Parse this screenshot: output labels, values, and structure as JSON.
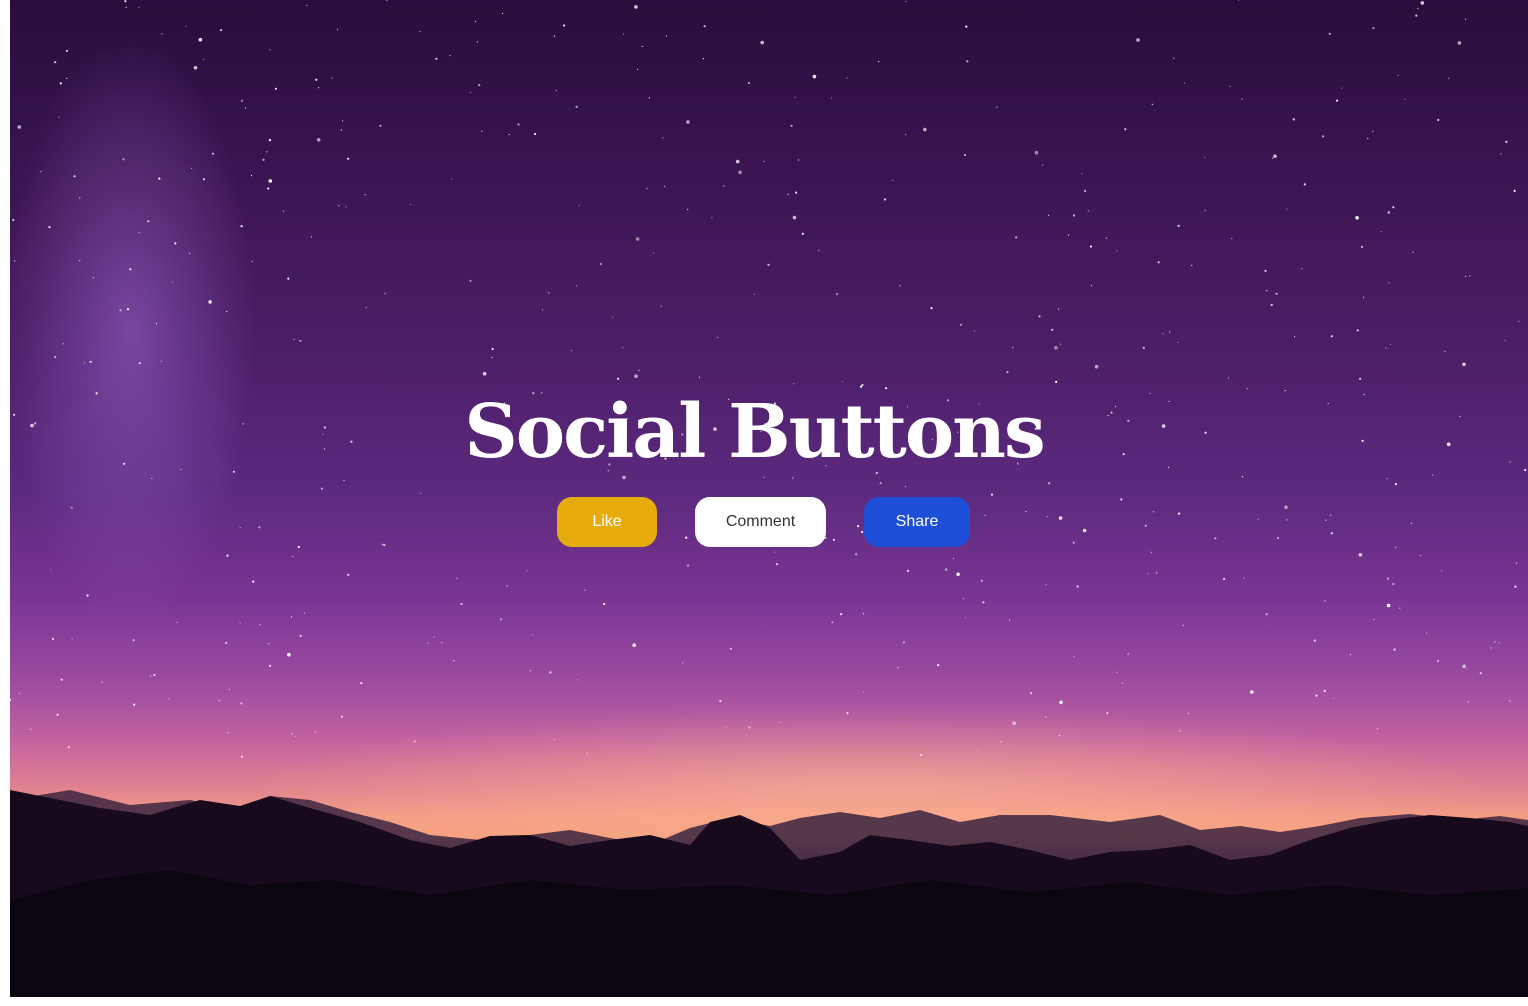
{
  "page": {
    "title": "Social Buttons"
  },
  "buttons": {
    "like_label": "Like",
    "comment_label": "Comment",
    "share_label": "Share"
  },
  "colors": {
    "like": "#e6ac0e",
    "comment": "#ffffff",
    "share": "#1d4fd8",
    "title_text": "#ffffff"
  },
  "background": {
    "scene": "starry night sky over mountains"
  }
}
